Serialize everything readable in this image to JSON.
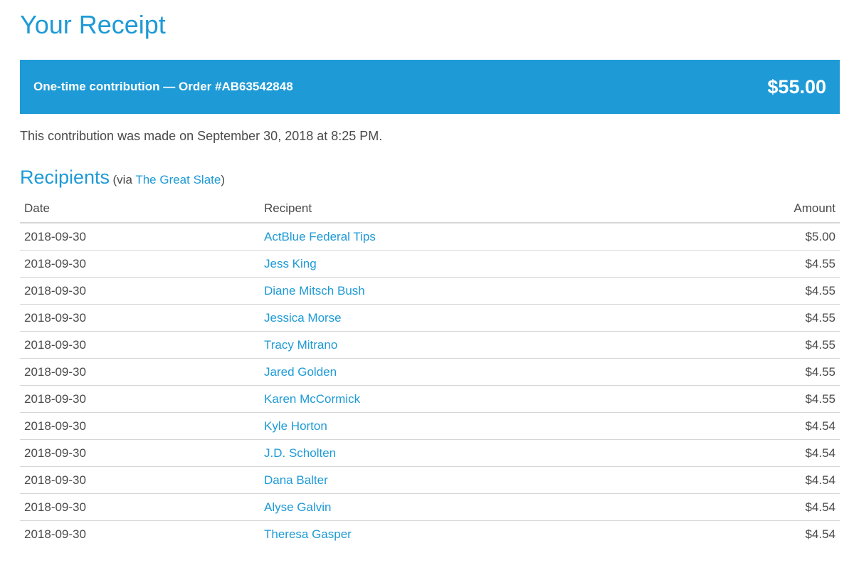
{
  "page": {
    "title": "Your Receipt"
  },
  "banner": {
    "description": "One-time contribution — Order #AB63542848",
    "amount": "$55.00"
  },
  "made_on_text": "This contribution was made on September 30, 2018 at 8:25 PM.",
  "recipients": {
    "heading": "Recipients",
    "via_prefix": "(via ",
    "via_link": "The Great Slate",
    "via_suffix": ")",
    "columns": {
      "date": "Date",
      "recipient": "Recipent",
      "amount": "Amount"
    },
    "rows": [
      {
        "date": "2018-09-30",
        "recipient": "ActBlue Federal Tips",
        "amount": "$5.00"
      },
      {
        "date": "2018-09-30",
        "recipient": "Jess King",
        "amount": "$4.55"
      },
      {
        "date": "2018-09-30",
        "recipient": "Diane Mitsch Bush",
        "amount": "$4.55"
      },
      {
        "date": "2018-09-30",
        "recipient": "Jessica Morse",
        "amount": "$4.55"
      },
      {
        "date": "2018-09-30",
        "recipient": "Tracy Mitrano",
        "amount": "$4.55"
      },
      {
        "date": "2018-09-30",
        "recipient": "Jared Golden",
        "amount": "$4.55"
      },
      {
        "date": "2018-09-30",
        "recipient": "Karen McCormick",
        "amount": "$4.55"
      },
      {
        "date": "2018-09-30",
        "recipient": "Kyle Horton",
        "amount": "$4.54"
      },
      {
        "date": "2018-09-30",
        "recipient": "J.D. Scholten",
        "amount": "$4.54"
      },
      {
        "date": "2018-09-30",
        "recipient": "Dana Balter",
        "amount": "$4.54"
      },
      {
        "date": "2018-09-30",
        "recipient": "Alyse Galvin",
        "amount": "$4.54"
      },
      {
        "date": "2018-09-30",
        "recipient": "Theresa Gasper",
        "amount": "$4.54"
      }
    ]
  },
  "colors": {
    "accent": "#1e9ad6",
    "text": "#4a4a4a",
    "divider": "#d6d6d6"
  }
}
